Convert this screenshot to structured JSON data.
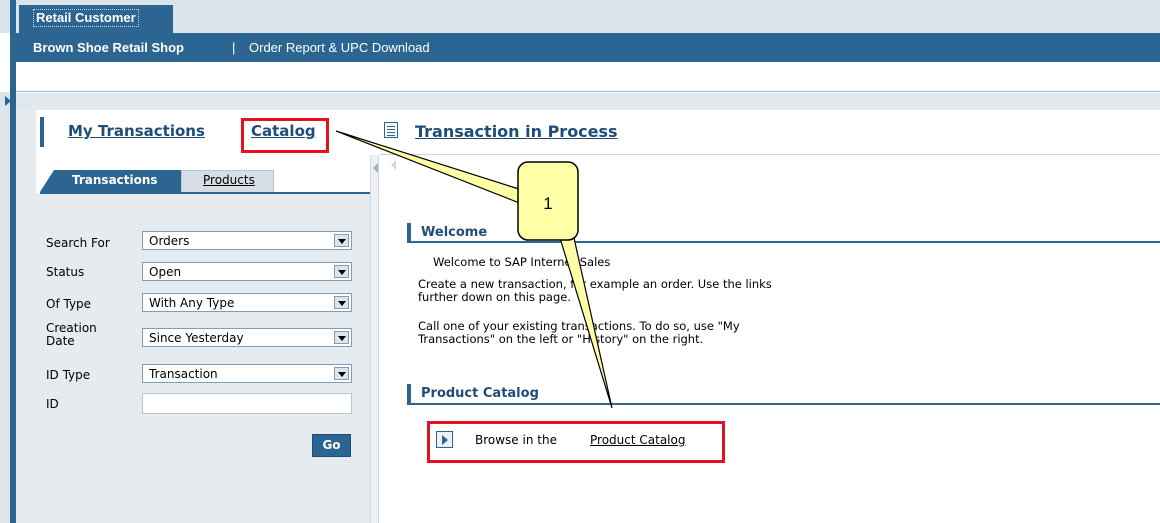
{
  "header": {
    "tab_label": "Retail Customer",
    "shop_name": "Brown Shoe Retail Shop",
    "separator": "|",
    "nav_link": "Order Report & UPC Download"
  },
  "left_panel": {
    "my_transactions": "My Transactions",
    "catalog": "Catalog",
    "tabs": [
      {
        "label": "Transactions",
        "active": true
      },
      {
        "label": "Products",
        "active": false
      }
    ],
    "fields": [
      {
        "label": "Search For",
        "value": "Orders"
      },
      {
        "label": "Status",
        "value": "Open"
      },
      {
        "label": "Of Type",
        "value": "With Any Type"
      },
      {
        "label": "Creation Date",
        "label_line1": "Creation",
        "label_line2": "Date",
        "value": "Since Yesterday"
      },
      {
        "label": "ID Type",
        "value": "Transaction"
      }
    ],
    "id_label": "ID",
    "id_value": "",
    "go_label": "Go"
  },
  "right_panel": {
    "title": "Transaction in Process",
    "welcome": {
      "title": "Welcome",
      "line1": "Welcome to SAP Internet Sales",
      "line2a": "Create a new transaction, for example an order. Use the links",
      "line2b": "further down on this page.",
      "line3a": "Call one of your existing transactions. To do so, use \"My",
      "line3b": "Transactions\" on the left or \"History\" on the right."
    },
    "product_catalog": {
      "title": "Product Catalog",
      "browse_text": "Browse in the",
      "browse_link": "Product Catalog"
    }
  },
  "annotation": {
    "callout_number": "1",
    "highlight_color": "#e8101e",
    "callout_fill": "#ffffa5"
  },
  "colors": {
    "brand_blue": "#2c6592",
    "link_blue": "#1f4d78",
    "panel_gray": "#e6ebf0"
  }
}
